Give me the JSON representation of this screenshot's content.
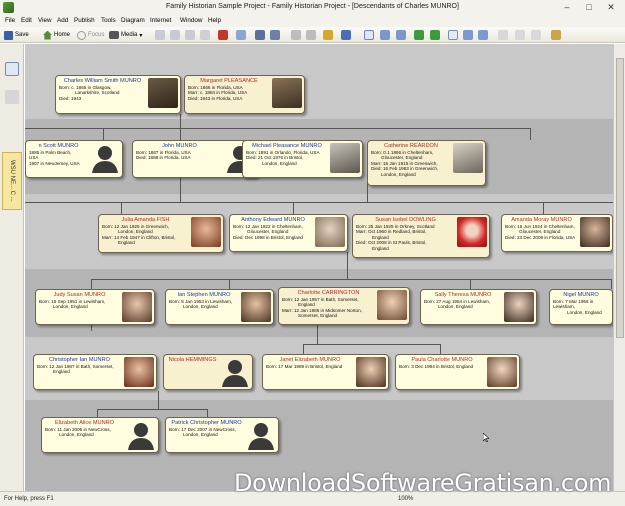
{
  "window": {
    "title": "Family Historian Sample Project - Family Historian Project - [Descendants of Charles MUNRO]",
    "minimize": "–",
    "maximize": "□",
    "close": "✕"
  },
  "menu": [
    "File",
    "Edit",
    "View",
    "Add",
    "Publish",
    "Tools",
    "Diagram",
    "Internet",
    "Window",
    "Help"
  ],
  "toolbar": {
    "save": "Save",
    "home": "Home",
    "focus": "Focus",
    "media": "Media"
  },
  "sidebar_tab": "WSU NE... C ...",
  "status": {
    "help": "For Help, press F1",
    "zoom": "100%"
  },
  "watermark": "DownloadSoftwareGratisan.com",
  "people": {
    "charles": {
      "name": "Charles William Smith MUNRO",
      "l1": "Born: c. 1865 in Glasgow,",
      "l2": "Lanarkshire, Scotland",
      "l3": "Died: 1943"
    },
    "margaret": {
      "name": "Margaret PLEASANCE",
      "l1": "Born: 1866 in Florida, USA",
      "l2": "Marr: c. 1884 in Florida, USA",
      "l3": "Died: 1943 in Florida, USA"
    },
    "scott": {
      "name": "n Scott MUNRO",
      "l1": "1885 in Palm Beach,",
      "l2": "USA",
      "l3": "1907 in NewJersey, USA"
    },
    "john": {
      "name": "John MUNRO",
      "l1": "Born: 1887 in Florida, USA",
      "l2": "Died: 1888 in Florida, USA",
      "l3": ""
    },
    "michael": {
      "name": "Michael Pleasance MUNRO",
      "l1": "Born: 1891 in Orlando, Florida, USA",
      "l2": "Died: 21 Oct 1976 in Bristol,",
      "l3": "London, England"
    },
    "catherine": {
      "name": "Catherine REARDON",
      "l1": "Born: 0.1 1886 in Cheltenham,",
      "l2": "Gloucester, England",
      "l3": "Marr: 15 Jan 1915 in Greenwich,",
      "l4": "Died: 16 Feb 1963 in Greenwich,",
      "l5": "London, England"
    },
    "julia": {
      "name": "Julia Amanda FISH",
      "l1": "Born: 12 Jan 1925 in Greenwich,",
      "l2": "London, England",
      "l3": "Marr: 14 Feb 1947 in Clifton, Bristol,",
      "l4": "England"
    },
    "anthony": {
      "name": "Anthony Edward MUNRO",
      "l1": "Born: 12 Jan 1922 in Cheltenham,",
      "l2": "Gloucester, England",
      "l3": "Died: Dec 1998 in Bristol, England"
    },
    "susan": {
      "name": "Susan Isobel DOWLING",
      "l1": "Born: 25 Jan 1925 in Orkney, Scotland",
      "l2": "Marr: Oct 1960 in Redland, Bristol,",
      "l3": "England",
      "l4": "Died: Oct 2008 in St Pauls, Bristol,",
      "l5": "England"
    },
    "amanda": {
      "name": "Amanda Moray MUNRO",
      "l1": "Born: 15 Jun 1924 in Cheltenham,",
      "l2": "Gloucester, England",
      "l3": "Died: 23 Dec 2009 in Florida, USA"
    },
    "judy": {
      "name": "Judy Susan MUNRO",
      "l1": "Born: 15 Sep 1951 in Lewisham,",
      "l2": "London, England"
    },
    "ian": {
      "name": "Ian Stephen MUNRO",
      "l1": "Born: 5 Jan 1953 in Lewisham,",
      "l2": "London, England"
    },
    "charlotte": {
      "name": "Charlotte CARRINGTON",
      "l1": "Born: 12 Jan 1957 in Bath, Somerset,",
      "l2": "England",
      "l3": "Marr: 12 Jan 1986 in Midsomer Norton,",
      "l4": "Somerset, England"
    },
    "sally": {
      "name": "Sally Theresa MUNRO",
      "l1": "Born: 27 Aug 1954 in Lewisham,",
      "l2": "London, England"
    },
    "nigel": {
      "name": "Nigel MUNRO",
      "l1": "Born: 7 Mar 1956 in Lewisham,",
      "l2": "London, England"
    },
    "christopher": {
      "name": "Christopher Ian MUNRO",
      "l1": "Born: 12 Jan 1987 in Bath, Somerset,",
      "l2": "England"
    },
    "nicola": {
      "name": "Nicola HEMMINGS"
    },
    "janet": {
      "name": "Janet Elizabeth MUNRO",
      "l1": "Born: 17 Mar 1989 in Bristol, England"
    },
    "paula": {
      "name": "Paula Charlotte MUNRO",
      "l1": "Born: 3 Dec 1994 in Bristol, England"
    },
    "elizabeth": {
      "name": "Elizabeth Alice MUNRO",
      "l1": "Born: 11 Jan 2006 in NewCross,",
      "l2": "London, England"
    },
    "patrick": {
      "name": "Patrick Christopher MUNRO",
      "l1": "Born: 17 Dec 2007 in NewCross,",
      "l2": "London, England"
    }
  },
  "colors": {
    "chart_bg": "#b4b4b4",
    "card_bg": "#fffddf",
    "male_name": "#1a37b0",
    "female_name": "#b02a2a"
  }
}
